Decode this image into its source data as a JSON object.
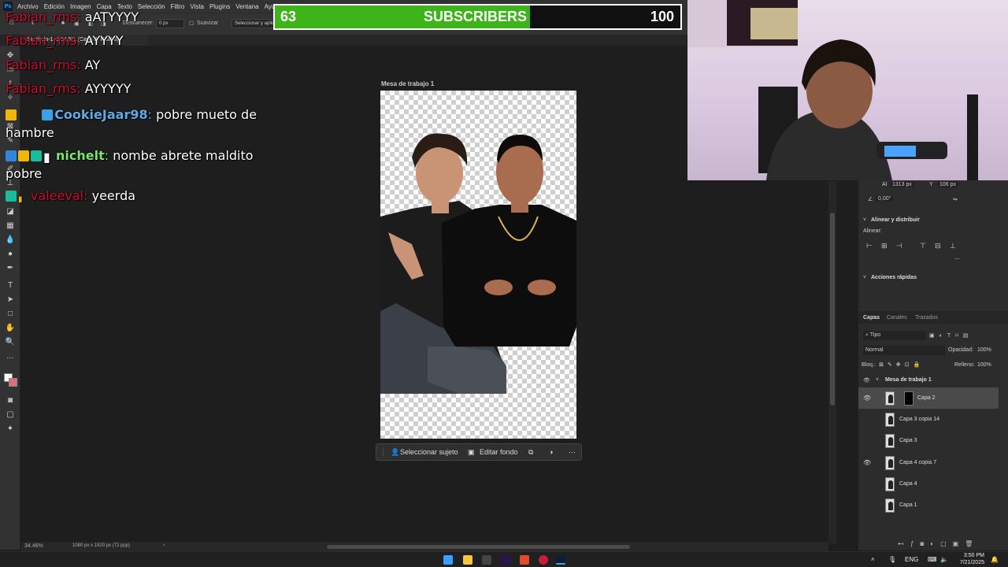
{
  "menubar": {
    "logo": "Ps",
    "items": [
      "Archivo",
      "Edición",
      "Imagen",
      "Capa",
      "Texto",
      "Selección",
      "Filtro",
      "Vista",
      "Plugins",
      "Ventana",
      "Ayuda"
    ]
  },
  "options": {
    "feather_label": "Desvanecer:",
    "feather_value": "0 px",
    "smooth_label": "Suavizar",
    "select_mask_label": "Seleccionar y aplicar máscara..."
  },
  "document": {
    "tab_title": "Sin título-1 al 34,5% (Capa 2, RGB/8) *",
    "artboard_label": "Mesa de trabajo 1",
    "zoom": "34.46%",
    "size_info": "1080 px x 1920 px (72 ppp)"
  },
  "context_bar": {
    "select_subject": "Seleccionar sujeto",
    "edit_background": "Editar fondo"
  },
  "properties": {
    "h_label": "Al",
    "h_value": "1313 px",
    "y_label": "Y",
    "y_value": "106 px",
    "angle_value": "0,00°",
    "align_title": "Alinear y distribuir",
    "align_label": "Alinear:",
    "quick_actions": "Acciones rápidas"
  },
  "layers_panel": {
    "tabs": [
      "Capas",
      "Canales",
      "Trazados"
    ],
    "filter_kind": "Tipo",
    "blend_mode": "Normal",
    "opacity_label": "Opacidad:",
    "opacity_value": "100%",
    "lock_label": "Bloq.:",
    "fill_label": "Relleno:",
    "fill_value": "100%",
    "group_name": "Mesa de trabajo 1",
    "layers": [
      {
        "name": "Capa 2",
        "visible": true,
        "selected": true
      },
      {
        "name": "Capa 3 copia 14",
        "visible": false,
        "selected": false
      },
      {
        "name": "Capa 3",
        "visible": false,
        "selected": false
      },
      {
        "name": "Capa 4 copia 7",
        "visible": true,
        "selected": false
      },
      {
        "name": "Capa 4",
        "visible": false,
        "selected": false
      },
      {
        "name": "Capa 1",
        "visible": false,
        "selected": false
      }
    ]
  },
  "subscriber_goal": {
    "current": "63",
    "label": "SUBSCRIBERS",
    "target": "100",
    "progress_fraction": 0.63,
    "fill_color": "#3cb41a"
  },
  "chat": {
    "messages": [
      {
        "user": "Fabian_rms",
        "text": "aATYYYY",
        "user_color": "#c8102e"
      },
      {
        "user": "Fabian_rms",
        "text": "AYYYY",
        "user_color": "#c8102e"
      },
      {
        "user": "Fabian_rms",
        "text": "AY",
        "user_color": "#c8102e"
      },
      {
        "user": "Fabian_rms",
        "text": "AYYYYY",
        "user_color": "#c8102e"
      },
      {
        "user": "CookieJaar98",
        "text": "pobre mueto de hambre",
        "user_color": "#5fa9e8"
      },
      {
        "user": "nichelt",
        "text": "nombe abrete maldito pobre",
        "user_color": "#7be36a"
      },
      {
        "user": "valeeval",
        "text": "yeerda",
        "user_color": "#c8102e"
      }
    ]
  },
  "taskbar": {
    "lang": "ENG",
    "time": "3:50 PM",
    "date": "7/21/2025"
  }
}
